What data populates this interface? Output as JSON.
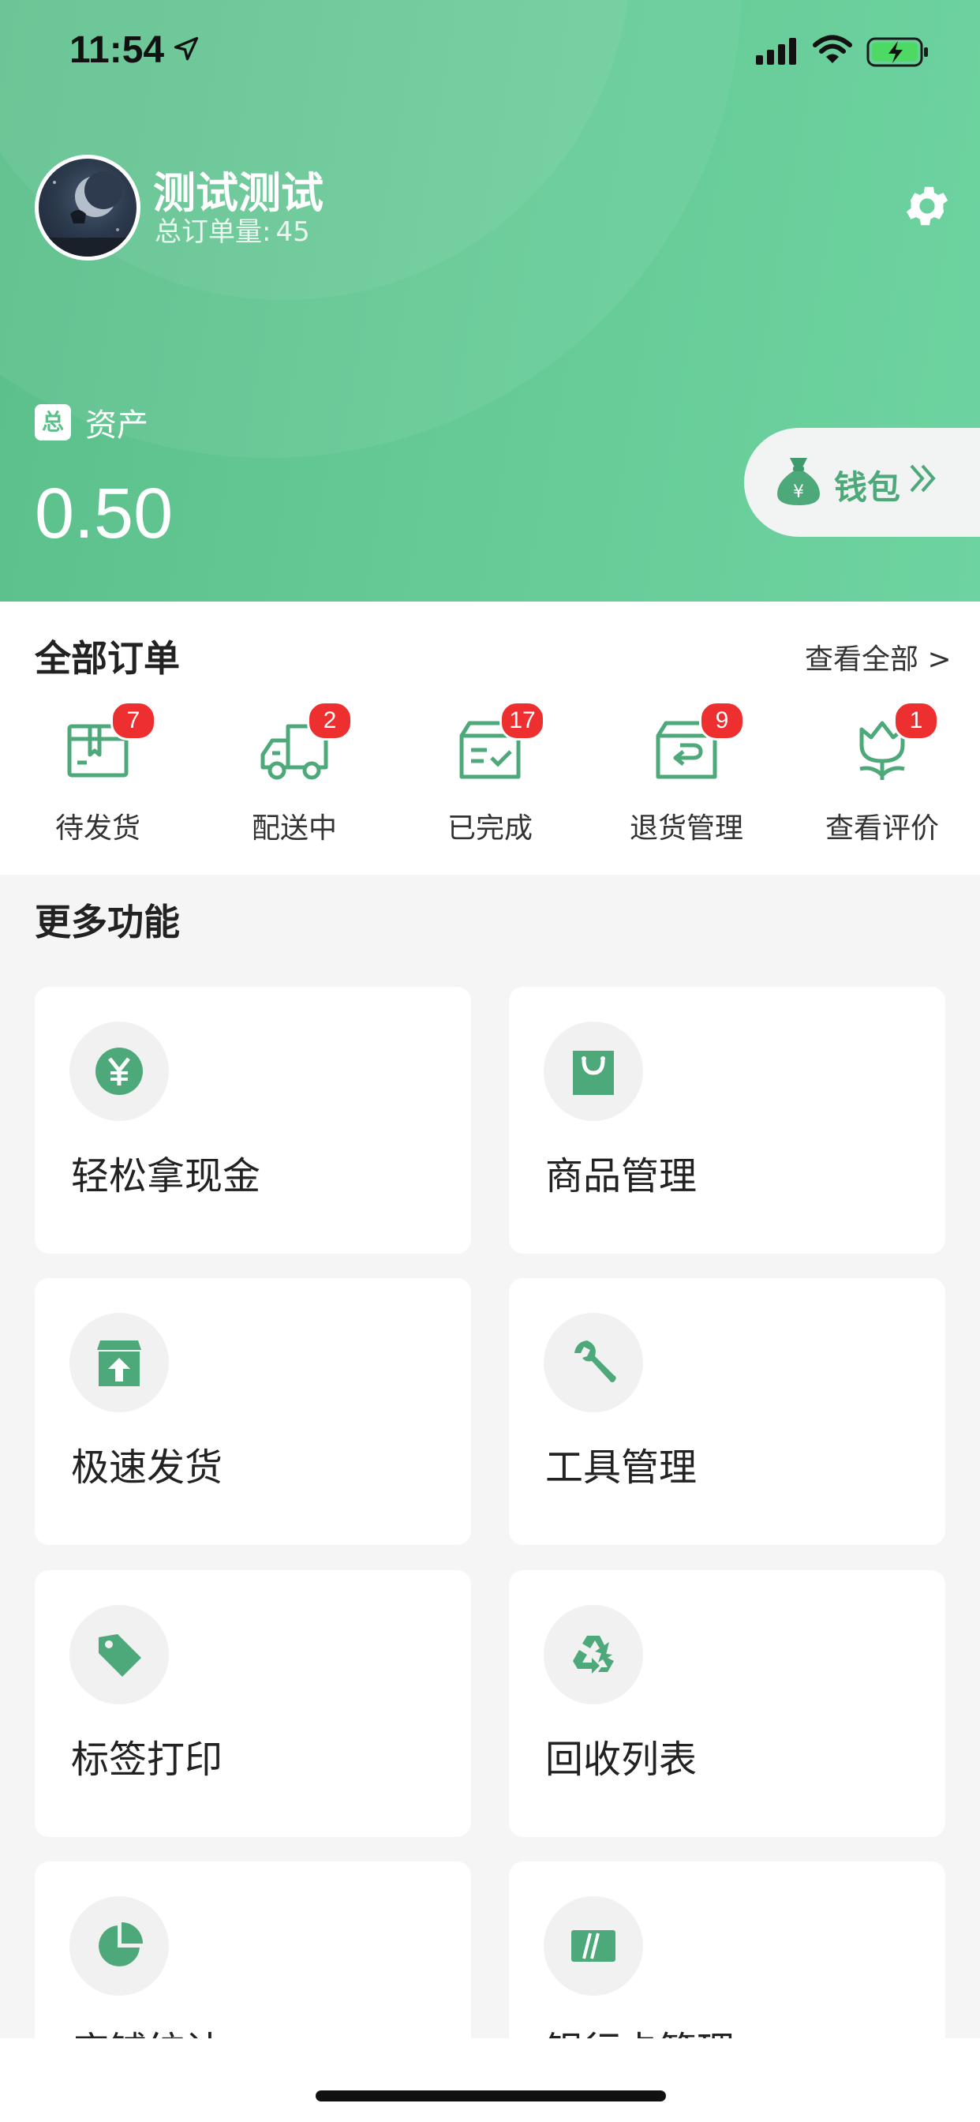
{
  "status_bar": {
    "time": "11:54"
  },
  "profile": {
    "name": "测试测试",
    "order_count_label": "总订单量:",
    "order_count_value": "45"
  },
  "assets": {
    "tag": "总",
    "label": "资产",
    "amount": "0.50",
    "wallet_label": "钱包"
  },
  "orders": {
    "title": "全部订单",
    "view_all": "查看全部 >",
    "items": [
      {
        "label": "待发货",
        "badge": "7",
        "icon": "box-icon"
      },
      {
        "label": "配送中",
        "badge": "2",
        "icon": "truck-icon"
      },
      {
        "label": "已完成",
        "badge": "17",
        "icon": "box-check-icon"
      },
      {
        "label": "退货管理",
        "badge": "9",
        "icon": "return-box-icon"
      },
      {
        "label": "查看评价",
        "badge": "1",
        "icon": "flower-icon"
      }
    ]
  },
  "more": {
    "title": "更多功能",
    "items": [
      {
        "label": "轻松拿现金",
        "icon": "yen-coin-icon"
      },
      {
        "label": "商品管理",
        "icon": "shopping-bag-icon"
      },
      {
        "label": "极速发货",
        "icon": "upload-box-icon"
      },
      {
        "label": "工具管理",
        "icon": "wrench-icon"
      },
      {
        "label": "标签打印",
        "icon": "tag-icon"
      },
      {
        "label": "回收列表",
        "icon": "recycle-icon"
      },
      {
        "label": "店铺统计",
        "icon": "pie-chart-icon"
      },
      {
        "label": "银行卡管理",
        "icon": "bank-card-icon"
      }
    ]
  },
  "colors": {
    "brand_green": "#5bbf8b",
    "badge_red": "#ee2f2f"
  }
}
